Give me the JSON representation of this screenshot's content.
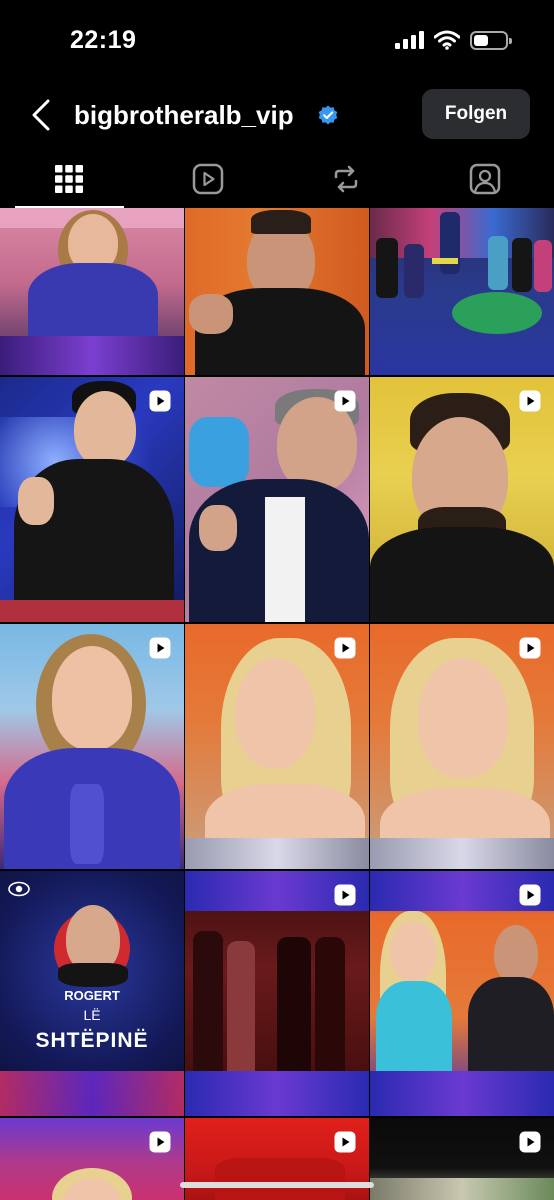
{
  "status": {
    "time": "22:19"
  },
  "header": {
    "username": "bigbrotheralb_vip",
    "verified": true,
    "follow_label": "Folgen"
  },
  "tabs": [
    {
      "name": "grid",
      "icon": "grid-icon",
      "active": true
    },
    {
      "name": "reels",
      "icon": "reels-icon",
      "active": false
    },
    {
      "name": "reposts",
      "icon": "repost-icon",
      "active": false
    },
    {
      "name": "tagged",
      "icon": "tagged-icon",
      "active": false
    }
  ],
  "posts": [
    {
      "type": "photo"
    },
    {
      "type": "photo"
    },
    {
      "type": "photo"
    },
    {
      "type": "reel"
    },
    {
      "type": "reel"
    },
    {
      "type": "reel"
    },
    {
      "type": "reel"
    },
    {
      "type": "reel"
    },
    {
      "type": "reel"
    },
    {
      "type": "photo",
      "name_text": "ROGERT",
      "line1": "LË",
      "line2": "SHTËPINË"
    },
    {
      "type": "reel"
    },
    {
      "type": "reel"
    },
    {
      "type": "reel"
    },
    {
      "type": "reel"
    },
    {
      "type": "reel"
    }
  ],
  "colors": {
    "background": "#000000",
    "follow_button_bg": "#2b2d31",
    "verified_blue": "#3897f0"
  }
}
